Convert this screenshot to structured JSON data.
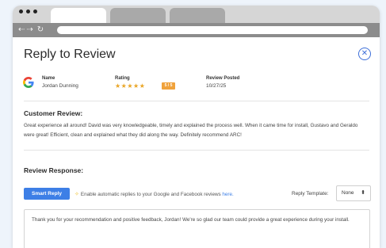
{
  "modal": {
    "title": "Reply to Review",
    "close_glyph": "✕"
  },
  "meta": {
    "name_label": "Name",
    "name_value": "Jordan Dunning",
    "rating_label": "Rating",
    "rating_stars": "★★★★★",
    "rating_value": 5,
    "rating_badge": "5 / 5",
    "posted_label": "Review Posted",
    "posted_value": "10/27/25"
  },
  "customer_review": {
    "heading": "Customer Review:",
    "text": "Great experience all around! David was very knowledgeable, timely and explained the process well. When it came time for install, Gustavo and Geraldo were great! Efficient, clean and explained what they did along the way. Definitely recommend ARC!"
  },
  "review_response": {
    "heading": "Review Response:",
    "smart_reply_label": "Smart Reply",
    "auto_reply_text": "Enable automatic replies to your Google and Facebook reviews ",
    "auto_reply_link": "here.",
    "template_label": "Reply Template:",
    "template_value": "None",
    "response_text": "Thank you for your recommendation and positive feedback, Jordan! We're so glad our team could provide a great experience during your install."
  },
  "icons": {
    "google": "google-logo-icon",
    "close": "close-icon",
    "sparkle": "sparkle-icon",
    "back": "back-arrow-icon",
    "forward": "forward-arrow-icon",
    "reload": "reload-icon"
  },
  "colors": {
    "accent": "#3d7fe6",
    "badge": "#f0a23c",
    "stars": "#e9a525",
    "background": "#eef4fb"
  }
}
